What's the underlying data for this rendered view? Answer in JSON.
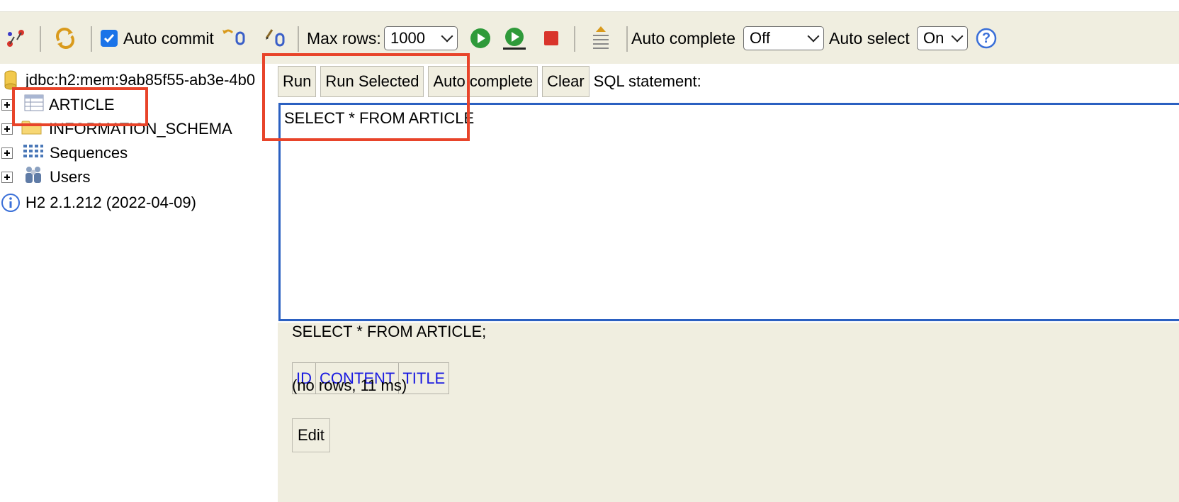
{
  "toolbar": {
    "icons": {
      "disconnect": "disconnect-icon",
      "refresh": "refresh-icon",
      "rollback": "rollback-icon",
      "commit": "commit-icon",
      "run": "run-icon",
      "run_selected": "run-selected-icon",
      "stop": "stop-icon",
      "history": "history-icon",
      "help": "help-icon"
    },
    "auto_commit_label": "Auto commit",
    "auto_commit_checked": true,
    "max_rows_label": "Max rows:",
    "max_rows_value": "1000",
    "auto_complete_label": "Auto complete",
    "auto_complete_value": "Off",
    "auto_select_label": "Auto select",
    "auto_select_value": "On",
    "help_glyph": "?"
  },
  "tree": {
    "connection": "jdbc:h2:mem:9ab85f55-ab3e-4b0",
    "items": [
      {
        "label": "ARTICLE",
        "icon": "table-icon"
      },
      {
        "label": "INFORMATION_SCHEMA",
        "icon": "folder-icon"
      },
      {
        "label": "Sequences",
        "icon": "sequences-icon"
      },
      {
        "label": "Users",
        "icon": "users-icon"
      }
    ],
    "version": "H2 2.1.212 (2022-04-09)"
  },
  "query": {
    "buttons": {
      "run": "Run",
      "run_selected": "Run Selected",
      "auto_complete": "Auto complete",
      "clear": "Clear"
    },
    "sql_label": "SQL statement:",
    "sql_text": "SELECT * FROM ARTICLE"
  },
  "result": {
    "statement": "SELECT * FROM ARTICLE;",
    "columns": [
      "ID",
      "CONTENT",
      "TITLE"
    ],
    "status": "(no rows, 11 ms)",
    "edit_button": "Edit"
  },
  "colors": {
    "toolbar_bg": "#f0eee0",
    "editor_border": "#2b60c1",
    "highlight": "#e8442a",
    "column_header": "#1a1ae0"
  }
}
